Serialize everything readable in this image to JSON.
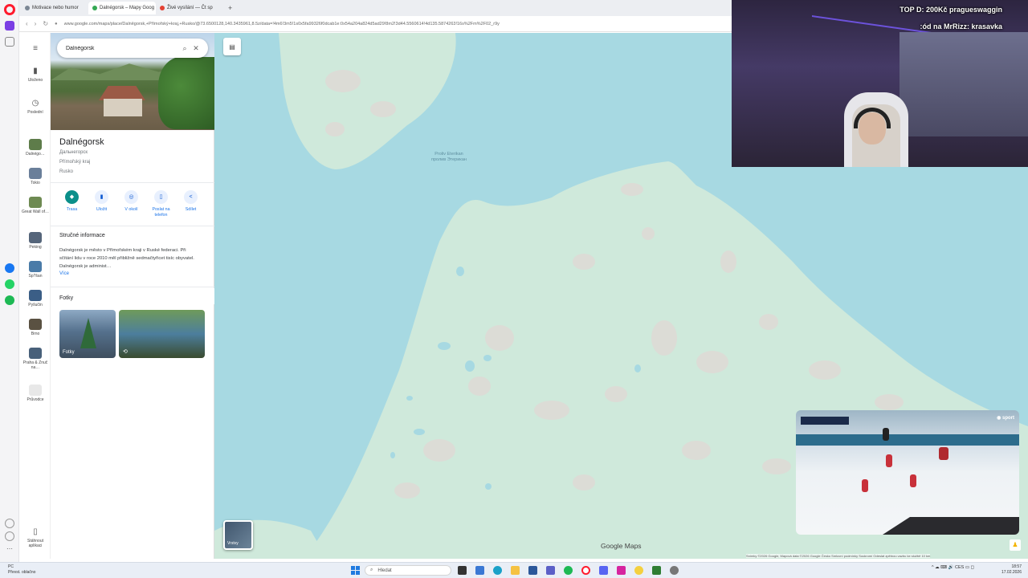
{
  "browser": {
    "tabs": [
      {
        "label": "Motivace nebo humor",
        "color": "#7b8794"
      },
      {
        "label": "Dalnégorsk – Mapy Goog",
        "color": "#34a853"
      },
      {
        "label": "Živé vysílání — Čt sp",
        "color": "#e34133"
      }
    ],
    "url": "www.google.com/maps/place/Dalněgorsk,+Přímořský+kraj,+Rusko/@73.6500128,140.3435961,8.5z/data=!4m6!3m5!1s0x5fa99326f0dcab1e:0x54a204a824d5ad29!8m2!3d44.5560614!4d135.5874263!16s%2Fm%2F02_r9y"
  },
  "rail": {
    "items": [
      {
        "label": "Uloženo",
        "icon": "bookmark-icon"
      },
      {
        "label": "Poslední",
        "icon": "history-icon"
      },
      {
        "label": "Dalnégo…"
      },
      {
        "label": "Tokio"
      },
      {
        "label": "Great Wall of…"
      },
      {
        "label": "Peking"
      },
      {
        "label": "Sp?šan"
      },
      {
        "label": "Pyšučin"
      },
      {
        "label": "Brno"
      },
      {
        "label": "Praha & Znuč na…"
      },
      {
        "label": "Průvodce"
      }
    ],
    "download": "Stáhnout aplikaci"
  },
  "panel": {
    "search_value": "Dalnégorsk",
    "title": "Dalnégorsk",
    "lines": [
      "Дальнегорск",
      "Přímořský kraj",
      "Rusko"
    ],
    "actions": [
      {
        "label": "Trasa",
        "icon": "directions-icon"
      },
      {
        "label": "Uložit",
        "icon": "bookmark-icon"
      },
      {
        "label": "V okolí",
        "icon": "nearby-icon"
      },
      {
        "label": "Poslat na telefon",
        "icon": "phone-icon"
      },
      {
        "label": "Sdílet",
        "icon": "share-icon"
      }
    ],
    "summary_title": "Stručné informace",
    "summary": "Dalnégorsk je město v Přímořském kraji v Ruské federaci. Při sčítání lidu v roce 2010 měl přibližně sedmačtyřicet tisíc obyvatel. Dalnégorsk je administ…",
    "more": "Více",
    "photos_title": "Fotky",
    "photo_label": "Fotky"
  },
  "map": {
    "label": "Proliv Eterikan\nпролив Этерикан",
    "brand": "Google Maps",
    "layers_label": "Vrstvy",
    "attribution": "Snímky ©2026 Google, Mapová data ©2026 Google   Česko   Smluvní podmínky   Soukromí   Odeslat zpětnou vazbu ke službě   10 km"
  },
  "stream": {
    "line1": "TOP D: 200Kč pragueswaggin",
    "line2": ":ód na MrRizz: krasavka"
  },
  "taskbar": {
    "weather_top": "PC",
    "weather_bottom": "Převst. oblačno",
    "search": "Hledat",
    "tray": "^  ☁  ⌨  🔊  CES  ▭  ◻",
    "time": "18:57",
    "date": "17.02.2026"
  },
  "colors": {
    "water": "#a7d9e2",
    "land": "#cfe9db",
    "brand": "#1a73e8",
    "opera": "#ff1b2d"
  }
}
